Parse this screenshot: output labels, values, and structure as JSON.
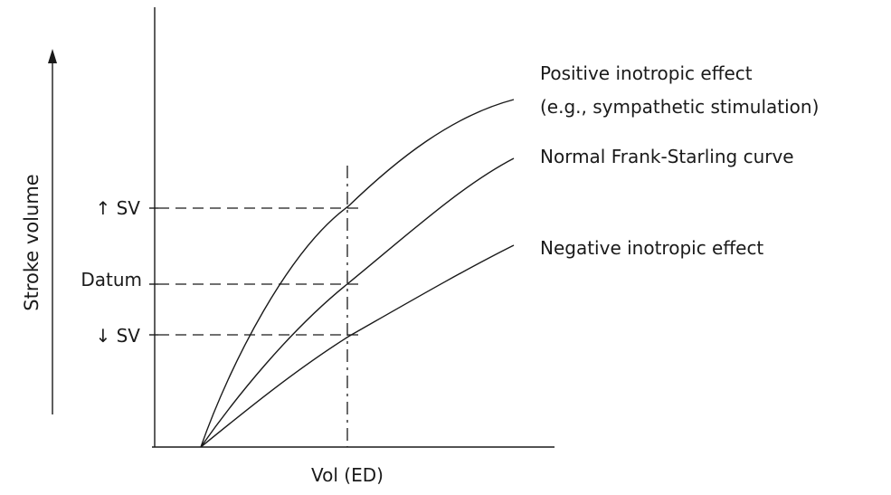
{
  "axes": {
    "y_label": "Stroke volume",
    "x_label": "Vol (ED)"
  },
  "y_markers": {
    "increased_sv": "↑ SV",
    "datum": "Datum",
    "decreased_sv": "↓ SV"
  },
  "curves": {
    "positive_line1": "Positive inotropic effect",
    "positive_line2": "(e.g., sympathetic stimulation)",
    "normal": "Normal Frank-Starling curve",
    "negative": "Negative inotropic effect"
  },
  "colors": {
    "ink": "#1a1a1a",
    "background": "#ffffff"
  }
}
